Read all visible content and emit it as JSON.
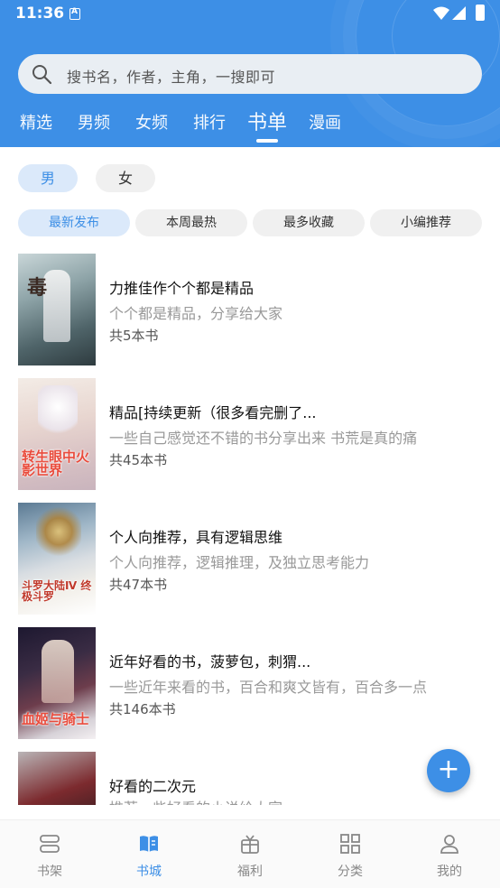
{
  "status_bar": {
    "time": "11:36"
  },
  "search": {
    "placeholder": "搜书名，作者，主角，一搜即可"
  },
  "tabs": [
    {
      "label": "精选",
      "active": false
    },
    {
      "label": "男频",
      "active": false
    },
    {
      "label": "女频",
      "active": false
    },
    {
      "label": "排行",
      "active": false
    },
    {
      "label": "书单",
      "active": true
    },
    {
      "label": "漫画",
      "active": false
    }
  ],
  "gender": {
    "male": "男",
    "female": "女",
    "selected": "男"
  },
  "filters": [
    {
      "label": "最新发布",
      "active": true
    },
    {
      "label": "本周最热",
      "active": false
    },
    {
      "label": "最多收藏",
      "active": false
    },
    {
      "label": "小编推荐",
      "active": false
    }
  ],
  "lists": [
    {
      "title": "力推佳作个个都是精品",
      "desc": "个个都是精品，分享给大家",
      "count": "共5本书",
      "cover_text": ""
    },
    {
      "title": "精品[持续更新（很多看完删了...",
      "desc": "一些自己感觉还不错的书分享出来 书荒是真的痛",
      "count": "共45本书",
      "cover_text": "转生眼中火影世界"
    },
    {
      "title": "个人向推荐，具有逻辑思维",
      "desc": "个人向推荐，逻辑推理，及独立思考能力",
      "count": "共47本书",
      "cover_text": "斗罗大陆Ⅳ 终极斗罗"
    },
    {
      "title": "近年好看的书，菠萝包，刺猬...",
      "desc": "一些近年来看的书，百合和爽文皆有，百合多一点",
      "count": "共146本书",
      "cover_text": "血姬与骑士"
    },
    {
      "title": "好看的二次元",
      "desc": "推荐一些好看的小说给大家",
      "count": "",
      "cover_text": ""
    }
  ],
  "fab": {
    "label": "+"
  },
  "bottom_nav": [
    {
      "label": "书架",
      "icon": "bookshelf-icon",
      "active": false
    },
    {
      "label": "书城",
      "icon": "bookstore-icon",
      "active": true
    },
    {
      "label": "福利",
      "icon": "gift-icon",
      "active": false
    },
    {
      "label": "分类",
      "icon": "category-grid-icon",
      "active": false
    },
    {
      "label": "我的",
      "icon": "profile-icon",
      "active": false
    }
  ],
  "colors": {
    "primary": "#3d8fe6",
    "chip_active_bg": "#dbe9fa",
    "chip_bg": "#f0f0f0"
  }
}
